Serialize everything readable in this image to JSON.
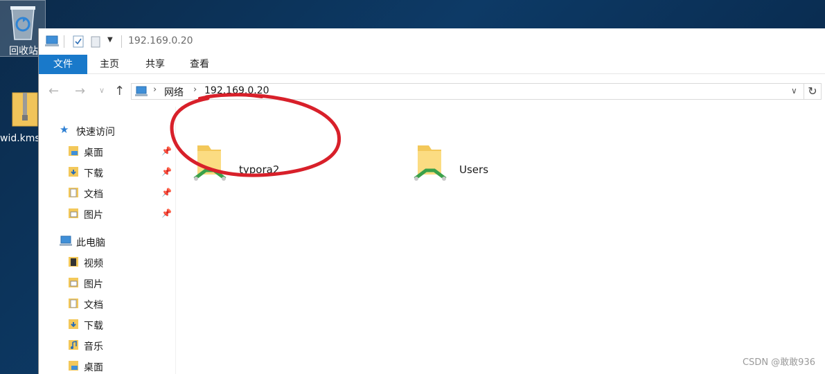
{
  "desktop": {
    "recycle_bin_label": "回收站",
    "zip_file_label": "wid.kms"
  },
  "window": {
    "title": "192.169.0.20",
    "ribbon_tabs": [
      {
        "label": "文件"
      },
      {
        "label": "主页"
      },
      {
        "label": "共享"
      },
      {
        "label": "查看"
      }
    ],
    "address": {
      "segments": [
        "网络",
        "192.169.0.20"
      ]
    }
  },
  "sidebar": {
    "quick_access": {
      "label": "快速访问",
      "items": [
        {
          "label": "桌面",
          "icon": "desktop-folder-icon",
          "pinned": true
        },
        {
          "label": "下载",
          "icon": "downloads-folder-icon",
          "pinned": true
        },
        {
          "label": "文档",
          "icon": "documents-folder-icon",
          "pinned": true
        },
        {
          "label": "图片",
          "icon": "pictures-folder-icon",
          "pinned": true
        }
      ]
    },
    "this_pc": {
      "label": "此电脑",
      "items": [
        {
          "label": "视频",
          "icon": "videos-folder-icon"
        },
        {
          "label": "图片",
          "icon": "pictures-folder-icon"
        },
        {
          "label": "文档",
          "icon": "documents-folder-icon"
        },
        {
          "label": "下载",
          "icon": "downloads-folder-icon"
        },
        {
          "label": "音乐",
          "icon": "music-folder-icon"
        },
        {
          "label": "桌面",
          "icon": "desktop-folder-icon"
        }
      ]
    }
  },
  "content": {
    "shares": [
      {
        "name": "typora2",
        "icon": "network-share-folder-icon",
        "annotated": true
      },
      {
        "name": "Users",
        "icon": "network-share-folder-icon",
        "annotated": false
      }
    ]
  },
  "colors": {
    "accent": "#1979ca",
    "annotation": "#d8202a",
    "folder": "#f3c85a"
  },
  "watermark": "CSDN @敢敢936"
}
